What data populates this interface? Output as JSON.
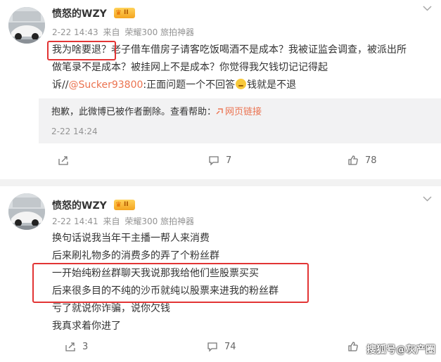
{
  "posts": [
    {
      "author": "愤怒的WZY",
      "badge_level": "II",
      "meta": {
        "date": "2-22 14:43",
        "source_prefix": "来自",
        "source": "荣耀300 旅拍神器"
      },
      "content_lines": [
        "我为啥要退？老子借车借房子请客吃饭喝酒不是成本？我被证监会调查，被派出所",
        "做笔录不是成本？被挂网上不是成本？你觉得我欠钱切记记得起",
        {
          "before": "诉//",
          "mention": "@Sucker93800",
          "after_a": ":正面问题一个不回答",
          "after_b": "钱就是不退"
        }
      ],
      "repost": {
        "notice": "抱歉，此微博已被作者删除。查看帮助：",
        "link_label": "网页链接",
        "time": "2-22 14:24"
      },
      "actions": {
        "repost": "",
        "comment": "7",
        "like": "78"
      }
    },
    {
      "author": "愤怒的WZY",
      "badge_level": "II",
      "meta": {
        "date": "2-22 14:41",
        "source_prefix": "来自",
        "source": "荣耀300 旅拍神器"
      },
      "content_lines": [
        "换句话说我当年干主播一帮人来消费",
        "后来刷礼物多的消费多的弄了个粉丝群",
        "一开始纯粉丝群聊天我说那我给他们些股票买买",
        "后来很多目的不纯的沙币就纯以股票来进我的粉丝群",
        "亏了就说你诈骗，说你欠钱",
        "我真求着你进了"
      ],
      "actions": {
        "repost": "3",
        "comment": "74",
        "like": ""
      }
    }
  ],
  "watermark": "搜狐号@灰产圈",
  "colors": {
    "link": "#eb7350",
    "highlight": "#e23434",
    "meta": "#939393"
  }
}
